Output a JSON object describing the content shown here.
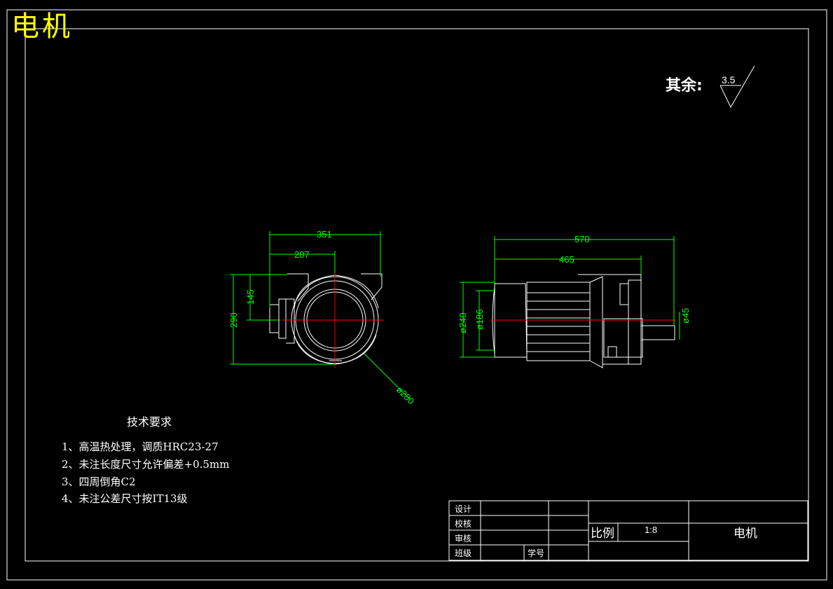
{
  "drawing": {
    "title": "电机",
    "roughness_label": "其余:",
    "roughness_value": "3.5"
  },
  "dimensions": {
    "front": {
      "width": "351",
      "partial_width": "207",
      "height": "290",
      "partial_height": "145",
      "diameter": "ø280"
    },
    "side": {
      "length": "570",
      "partial_length": "465",
      "dia_outer": "ø240",
      "dia_inner": "ø186",
      "shaft_dia": "ø45"
    }
  },
  "tech_requirements": {
    "title": "技术要求",
    "items": [
      "1、高温热处理，调质HRC23-27",
      "2、未注长度尺寸允许偏差+0.5mm",
      "3、四周倒角C2",
      "4、未注公差尺寸按IT13级"
    ]
  },
  "title_block": {
    "design": "设计",
    "check": "校核",
    "review": "审核",
    "class": "班级",
    "student_id": "学号",
    "scale_label": "比例",
    "scale_value": "1:8",
    "part_name": "电机"
  },
  "colors": {
    "background": "#000000",
    "outline": "#ffffff",
    "dimension": "#00ff00",
    "centerline": "#ff0000",
    "title": "#ffff00"
  }
}
